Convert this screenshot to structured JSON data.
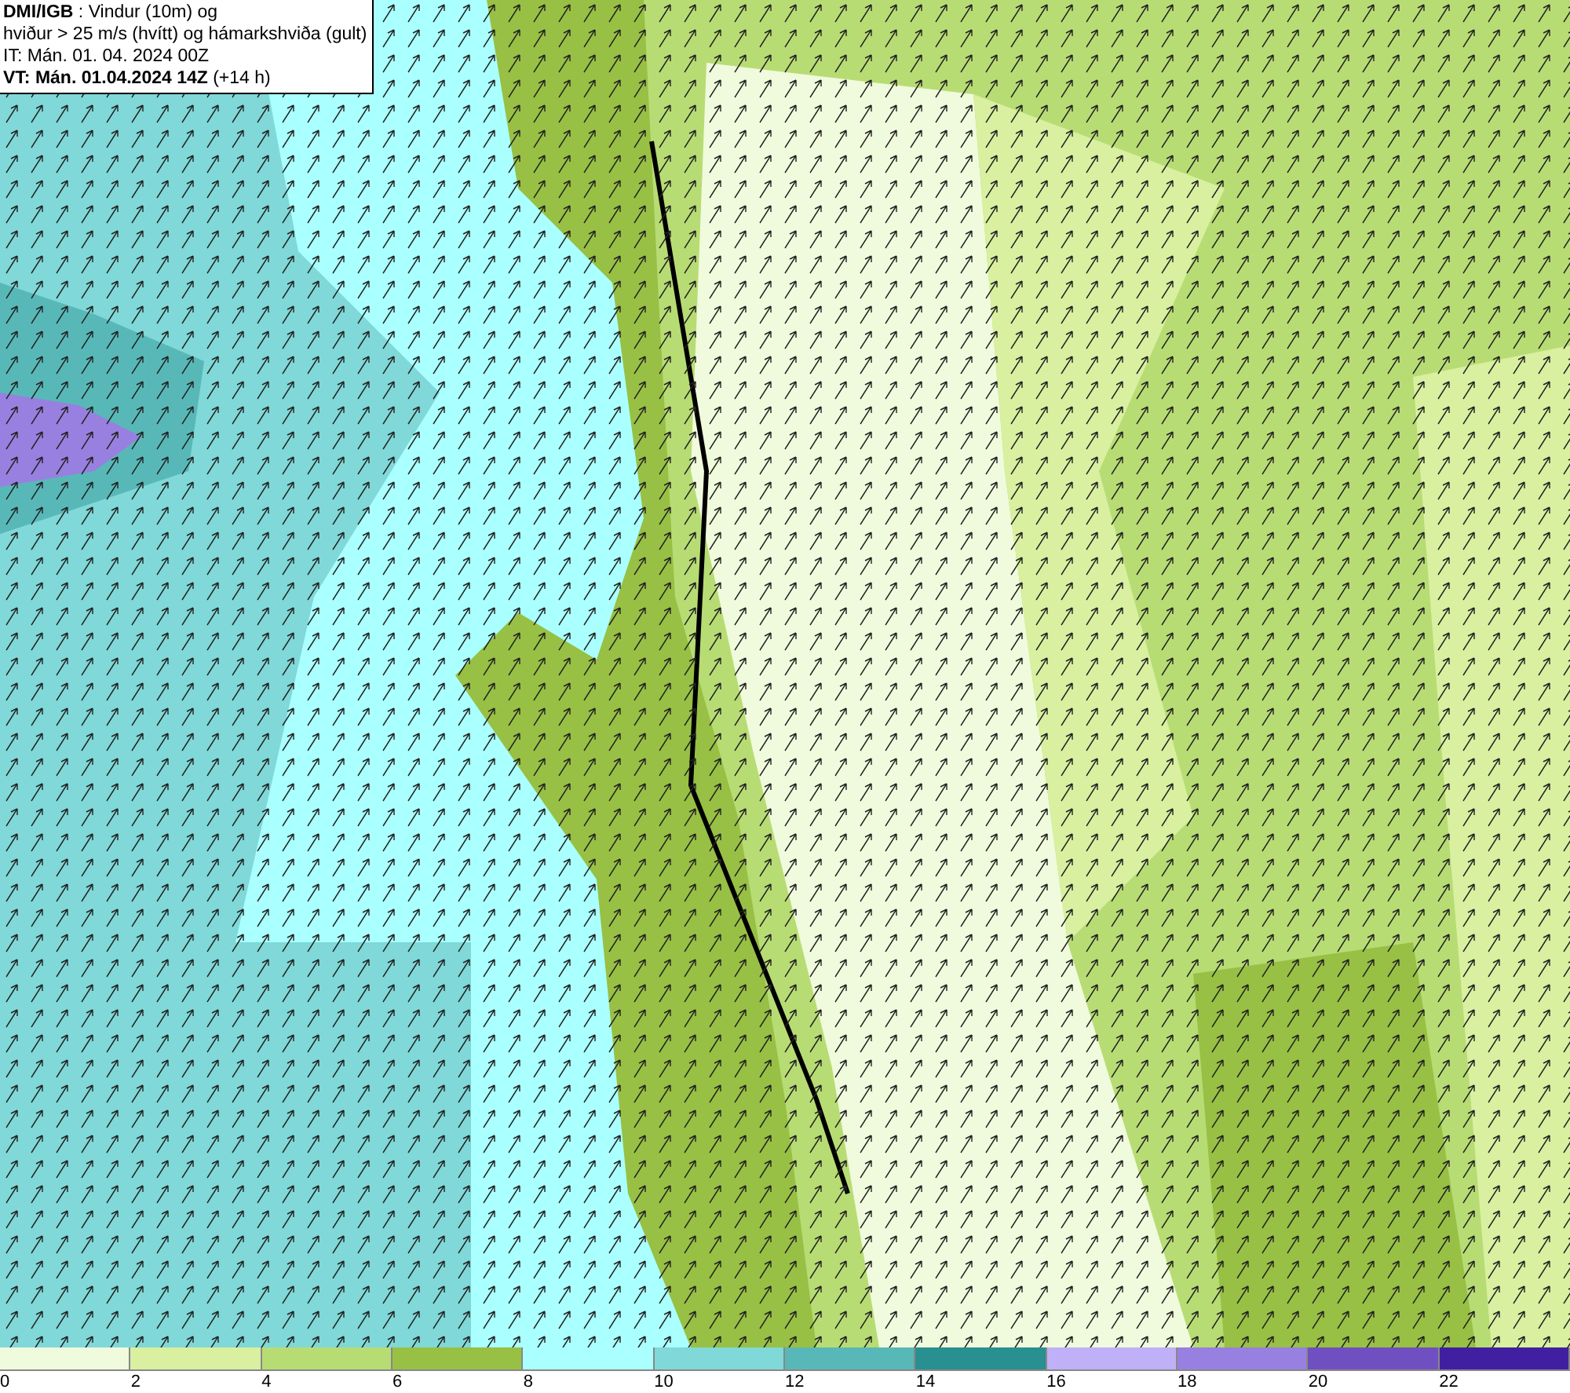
{
  "header": {
    "lines": [
      "**DMI/IGB** : Vindur (10m) og",
      "hviður > 25 m/s (hvítt) og hámarkshviða (gult)",
      "IT: Mán. 01. 04. 2024 00Z",
      "**VT: Mán. 01.04.2024 14Z** (+14 h)"
    ]
  },
  "legend": [
    {
      "label": "0",
      "color": "#f0fadc"
    },
    {
      "label": "2",
      "color": "#d8f0a0"
    },
    {
      "label": "4",
      "color": "#b8dc74"
    },
    {
      "label": "6",
      "color": "#98c044"
    },
    {
      "label": "8",
      "color": "#aaffff"
    },
    {
      "label": "10",
      "color": "#80d8d8"
    },
    {
      "label": "12",
      "color": "#58b8b8"
    },
    {
      "label": "14",
      "color": "#289090"
    },
    {
      "label": "16",
      "color": "#c0b0f8"
    },
    {
      "label": "18",
      "color": "#9880e0"
    },
    {
      "label": "20",
      "color": "#7050c0"
    },
    {
      "label": "22",
      "color": "#4020a0"
    }
  ]
}
